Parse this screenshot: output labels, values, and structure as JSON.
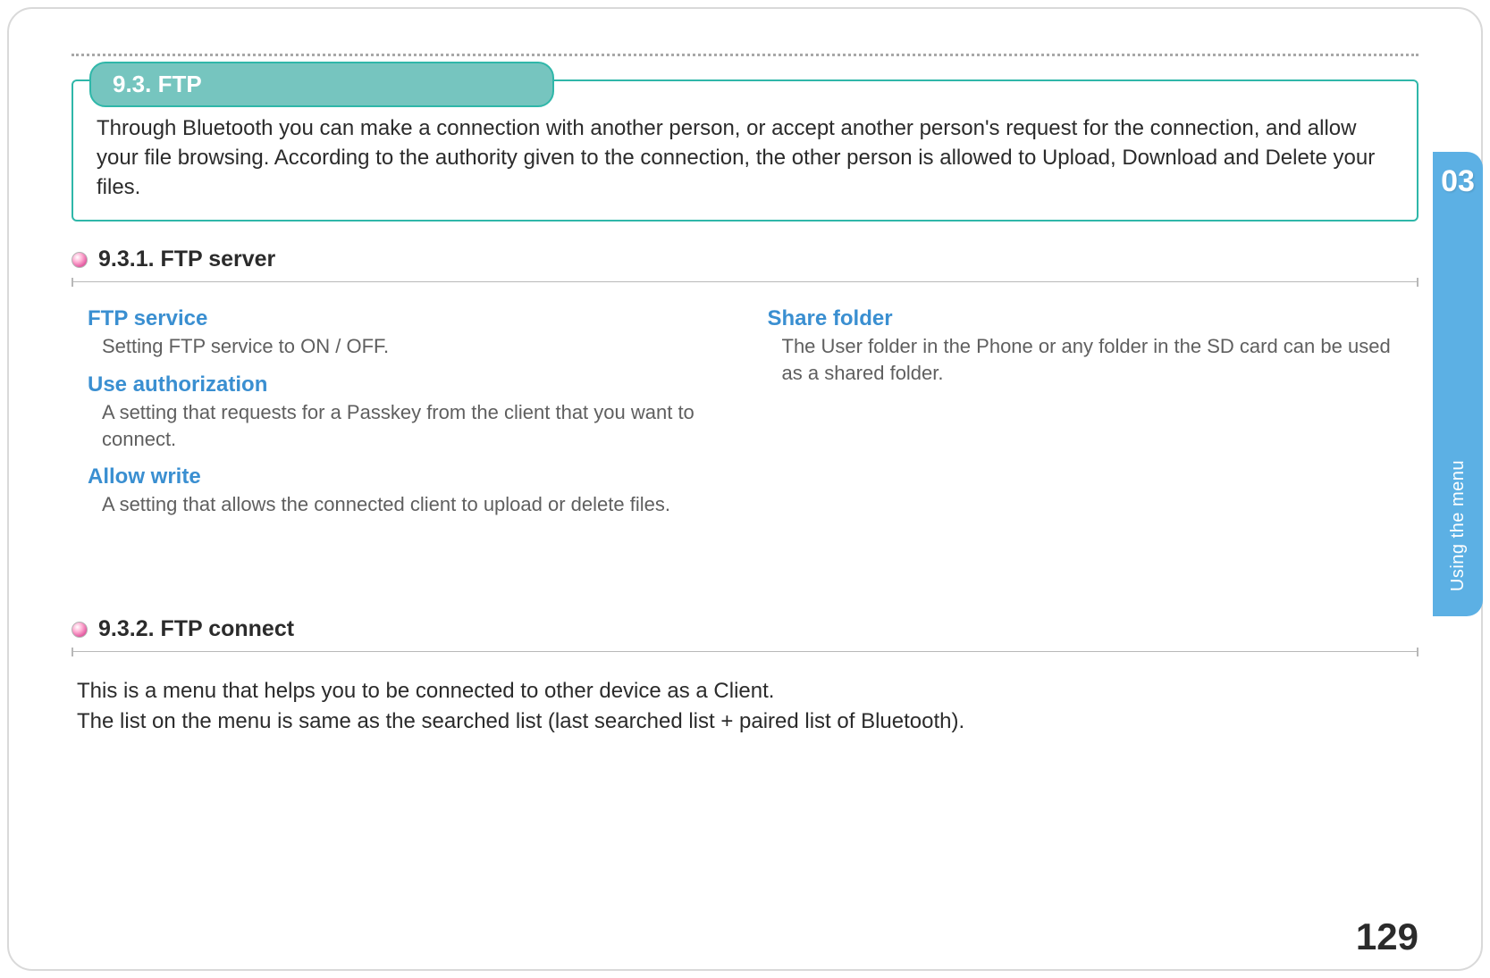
{
  "callout": {
    "tab": "9.3. FTP",
    "body": "Through Bluetooth you can make a connection with another person, or accept another person's request for the connection, and allow your file browsing. According to the authority given to the connection, the other person is allowed to Upload, Download and Delete your files."
  },
  "section1": {
    "heading": "9.3.1. FTP server",
    "left": [
      {
        "title": "FTP service",
        "desc": "Setting FTP service to ON / OFF."
      },
      {
        "title": "Use authorization",
        "desc": "A setting that requests for a Passkey from the client that you want to connect."
      },
      {
        "title": "Allow write",
        "desc": "A setting that allows the connected client to upload or delete files."
      }
    ],
    "right": [
      {
        "title": "Share folder",
        "desc": "The User folder in the Phone or any folder in the SD card can be used as a shared folder."
      }
    ]
  },
  "section2": {
    "heading": "9.3.2. FTP connect",
    "body_line1": "This is a menu that helps you to be connected to other device as a Client.",
    "body_line2": "The list on the menu is same as the searched list (last searched list + paired list of Bluetooth)."
  },
  "sidetab": {
    "num": "03",
    "label": "Using the menu"
  },
  "page_number": "129"
}
